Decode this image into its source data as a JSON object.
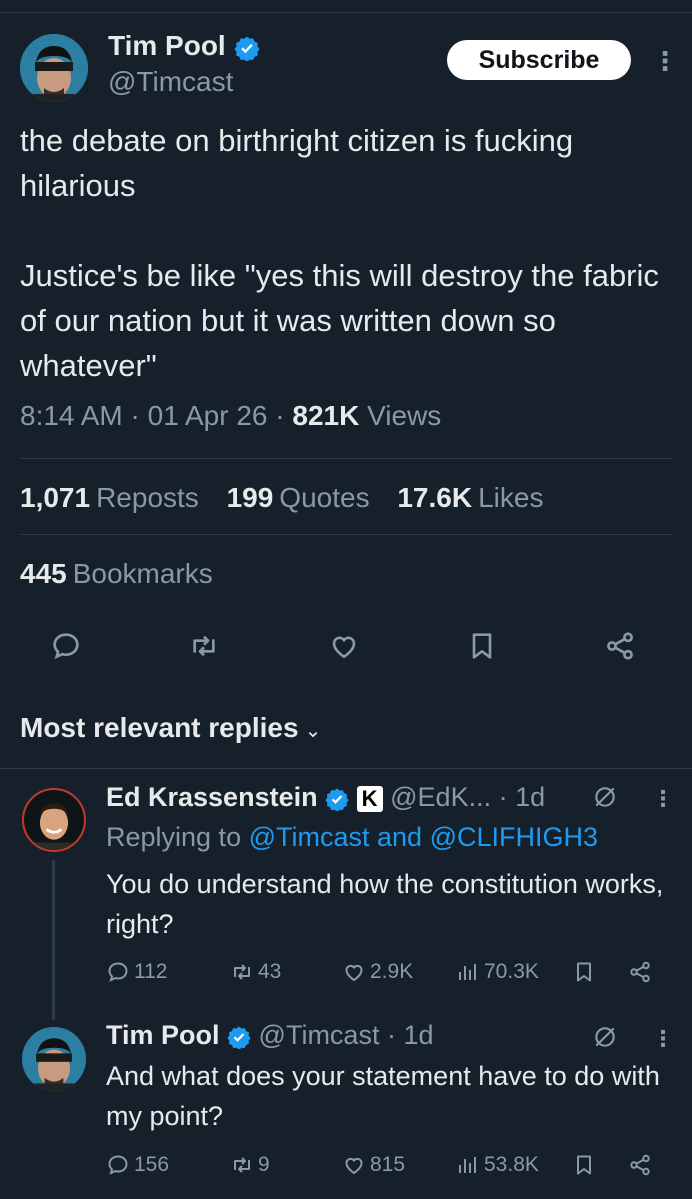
{
  "colors": {
    "background": "#15202b",
    "text": "#e7e9ea",
    "muted": "#8b98a5",
    "link": "#1d9bf0",
    "divider": "#2f3b47"
  },
  "post": {
    "author_name": "Tim Pool",
    "author_handle": "@Timcast",
    "subscribe_label": "Subscribe",
    "text": "the debate on birthright citizen is fucking hilarious\n\nJustice's be like \"yes this will destroy the fabric of our nation but it was written down so whatever\"",
    "time": "8:14 AM",
    "date": "01 Apr 26",
    "views_count": "821K",
    "views_label": "Views",
    "reposts_count": "1,071",
    "reposts_label": "Reposts",
    "quotes_count": "199",
    "quotes_label": "Quotes",
    "likes_count": "17.6K",
    "likes_label": "Likes",
    "bookmarks_count": "445",
    "bookmarks_label": "Bookmarks"
  },
  "replies_header": "Most relevant replies",
  "replies": [
    {
      "author_name": "Ed Krassenstein",
      "handle": "@EdK...",
      "age": "1d",
      "replying_prefix": "Replying to",
      "replying_to": "@Timcast and @CLIFHIGH3",
      "text": "You do understand how the constitution works, right?",
      "replies": "112",
      "reposts": "43",
      "likes": "2.9K",
      "views": "70.3K"
    },
    {
      "author_name": "Tim Pool",
      "handle": "@Timcast",
      "age": "1d",
      "text": "And what does your statement have to do with my point?",
      "replies": "156",
      "reposts": "9",
      "likes": "815",
      "views": "53.8K"
    }
  ]
}
